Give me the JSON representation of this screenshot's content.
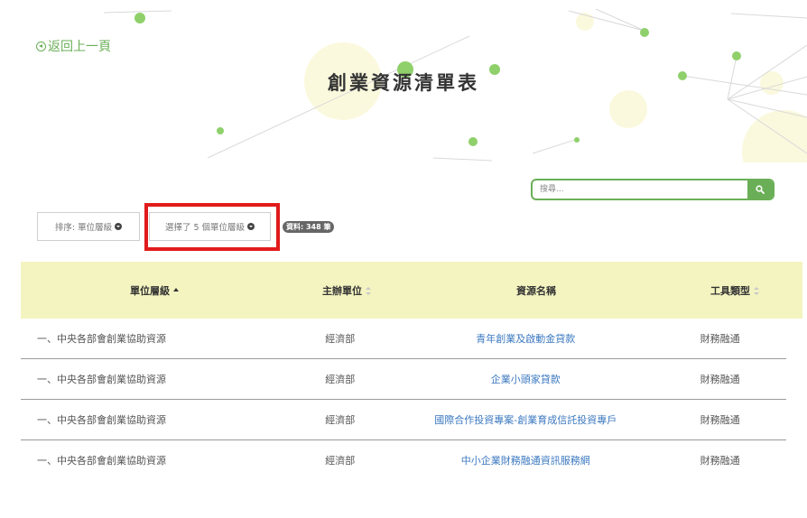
{
  "nav": {
    "back_label": "返回上一頁"
  },
  "page": {
    "title": "創業資源清單表"
  },
  "search": {
    "placeholder": "搜尋..."
  },
  "toolbar": {
    "sort_label": "排序: 單位層級",
    "filter_label": "選擇了 5 個單位層級",
    "count_badge": "資料: 348 筆"
  },
  "table": {
    "headers": [
      "單位層級",
      "主辦單位",
      "資源名稱",
      "工具類型"
    ],
    "rows": [
      [
        "一、中央各部會創業協助資源",
        "經濟部",
        "青年創業及啟動金貸款",
        "財務融通"
      ],
      [
        "一、中央各部會創業協助資源",
        "經濟部",
        "企業小頭家貸款",
        "財務融通"
      ],
      [
        "一、中央各部會創業協助資源",
        "經濟部",
        "國際合作投資專案-創業育成信託投資專戶",
        "財務融通"
      ],
      [
        "一、中央各部會創業協助資源",
        "經濟部",
        "中小企業財務融通資訊服務網",
        "財務融通"
      ]
    ]
  },
  "colors": {
    "accent_green": "#6aaf57",
    "header_bg": "#f4f4c1",
    "link_blue": "#3b78c0",
    "highlight_red": "#e11b1b"
  },
  "icons": {
    "back": "arrow-circle-left-icon",
    "search": "search-icon",
    "dropdown": "caret-circle-down-icon",
    "sort_asc": "sort-asc-icon",
    "sort_none": "sort-icon"
  }
}
